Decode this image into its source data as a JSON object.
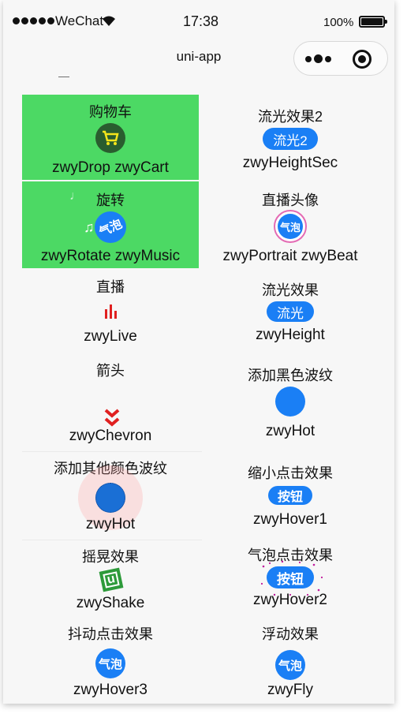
{
  "status_bar": {
    "carrier": "WeChat",
    "time": "17:38",
    "battery": "100%"
  },
  "nav": {
    "title": "uni-app"
  },
  "cells": {
    "cart": {
      "title": "购物车",
      "name": "zwyDrop zwyCart"
    },
    "rotate": {
      "title": "旋转",
      "name": "zwyRotate zwyMusic",
      "icon_text": "气泡"
    },
    "live": {
      "title": "直播",
      "name": "zwyLive"
    },
    "chevron": {
      "title": "箭头",
      "name": "zwyChevron"
    },
    "hot_color": {
      "title": "添加其他颜色波纹",
      "name": "zwyHot"
    },
    "shake": {
      "title": "摇晃效果",
      "name": "zwyShake",
      "icon_text": "u"
    },
    "hover3": {
      "title": "抖动点击效果",
      "name": "zwyHover3",
      "icon_text": "气泡"
    },
    "height_sec": {
      "title": "流光效果2",
      "name": "zwyHeightSec",
      "btn": "流光2"
    },
    "portrait": {
      "title": "直播头像",
      "name": "zwyPortrait zwyBeat",
      "icon_text": "气泡"
    },
    "height": {
      "title": "流光效果",
      "name": "zwyHeight",
      "btn": "流光"
    },
    "hot_black": {
      "title": "添加黑色波纹",
      "name": "zwyHot"
    },
    "hover1": {
      "title": "缩小点击效果",
      "name": "zwyHover1",
      "btn": "按钮"
    },
    "hover2": {
      "title": "气泡点击效果",
      "name": "zwyHover2",
      "btn": "按钮"
    },
    "fly": {
      "title": "浮动效果",
      "name": "zwyFly",
      "icon_text": "气泡"
    }
  },
  "colors": {
    "green": "#4cd964",
    "blue": "#1a7ff5",
    "live_red": "#e02020",
    "cart_dark": "#2a5d2f",
    "cart_yellow": "#f5e51b"
  }
}
